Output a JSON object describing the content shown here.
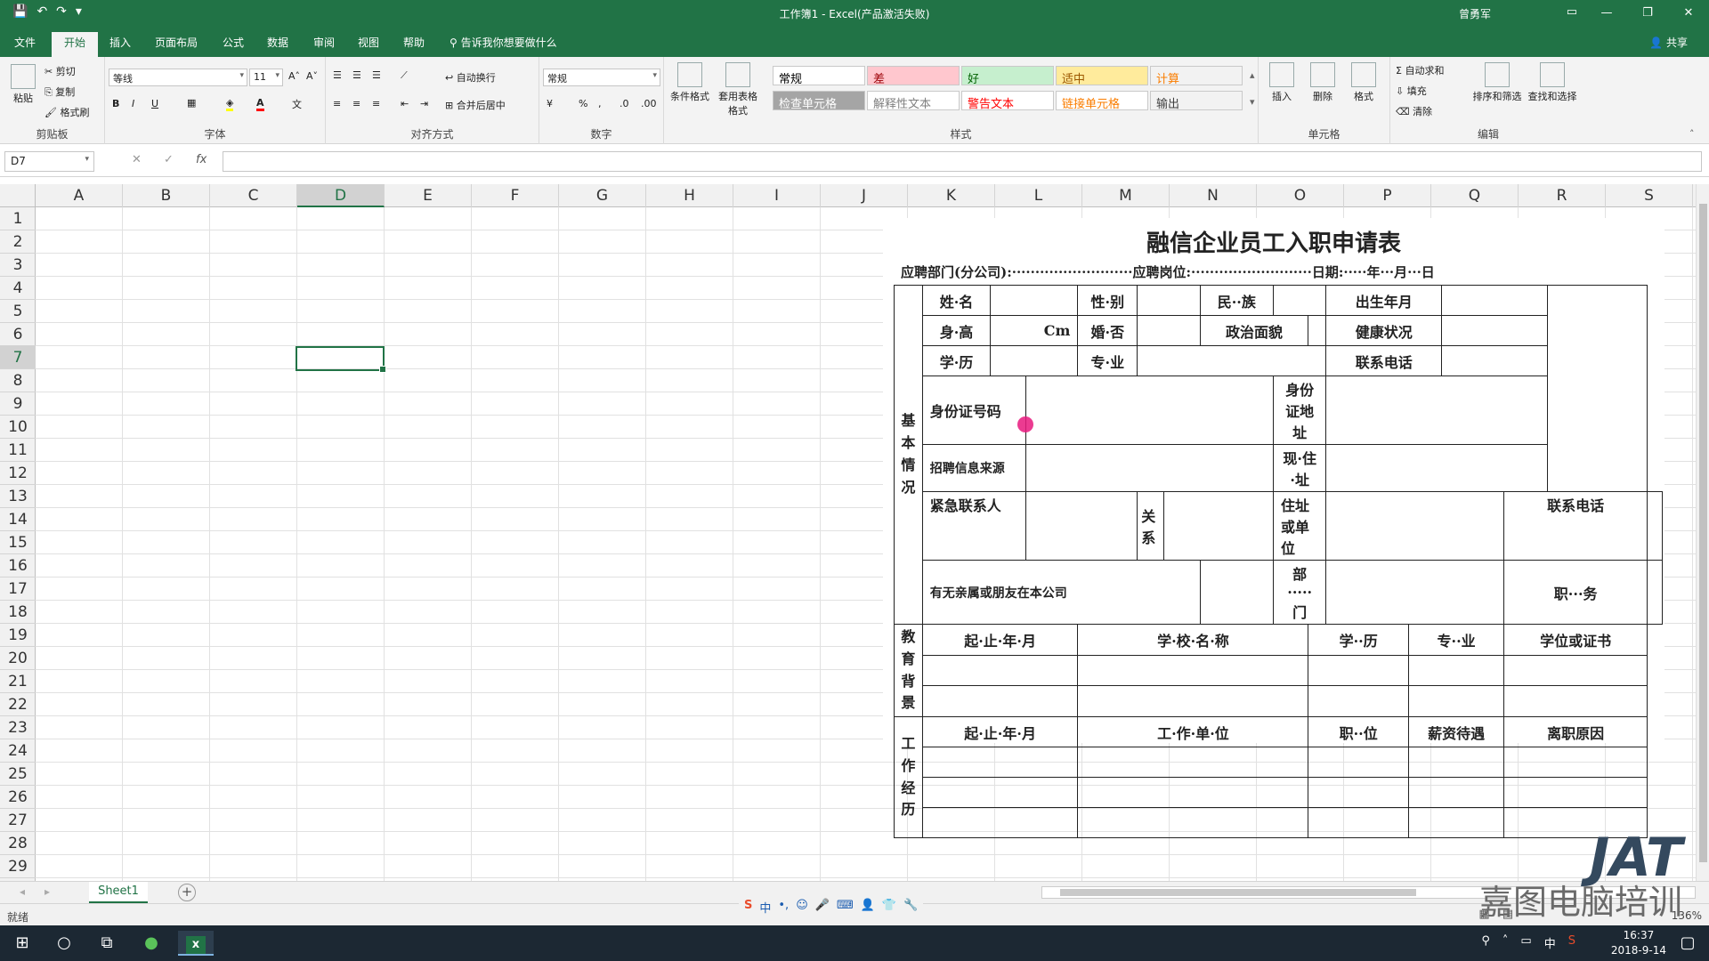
{
  "window": {
    "title": "工作簿1 - Excel(产品激活失败)",
    "user": "曾勇军",
    "minimize": "—",
    "restore": "❐",
    "close": "✕"
  },
  "qat": {
    "save": "💾",
    "undo": "↶",
    "redo": "↷",
    "customize": "▾"
  },
  "tabs": [
    "文件",
    "开始",
    "插入",
    "页面布局",
    "公式",
    "数据",
    "审阅",
    "视图",
    "帮助"
  ],
  "tell_me": "告诉我你想要做什么",
  "share": "共享",
  "ribbon": {
    "clipboard": {
      "label": "剪贴板",
      "paste": "粘贴",
      "cut": "剪切",
      "copy": "复制",
      "format_painter": "格式刷"
    },
    "font": {
      "label": "字体",
      "name": "等线",
      "size": "11",
      "bold": "B",
      "italic": "I",
      "underline": "U",
      "grow": "A˄",
      "shrink": "A˅"
    },
    "alignment": {
      "label": "对齐方式",
      "wrap": "自动换行",
      "merge": "合并后居中"
    },
    "number": {
      "label": "数字",
      "format": "常规",
      "percent": "%",
      "comma": ","
    },
    "styles": {
      "label": "样式",
      "conditional": "条件格式",
      "as_table": "套用表格格式",
      "cells": [
        {
          "text": "常规",
          "bg": "#ffffff",
          "fg": "#000000"
        },
        {
          "text": "差",
          "bg": "#ffc7ce",
          "fg": "#9c0006"
        },
        {
          "text": "好",
          "bg": "#c6efce",
          "fg": "#006100"
        },
        {
          "text": "适中",
          "bg": "#ffeb9c",
          "fg": "#9c5700"
        },
        {
          "text": "计算",
          "bg": "#f2f2f2",
          "fg": "#fa7d00"
        },
        {
          "text": "检查单元格",
          "bg": "#a5a5a5",
          "fg": "#ffffff"
        },
        {
          "text": "解释性文本",
          "bg": "#ffffff",
          "fg": "#7f7f7f"
        },
        {
          "text": "警告文本",
          "bg": "#ffffff",
          "fg": "#ff0000"
        },
        {
          "text": "链接单元格",
          "bg": "#ffffff",
          "fg": "#fa7d00"
        },
        {
          "text": "输出",
          "bg": "#f2f2f2",
          "fg": "#3f3f3f"
        }
      ]
    },
    "cells": {
      "label": "单元格",
      "insert": "插入",
      "delete": "删除",
      "format": "格式"
    },
    "editing": {
      "label": "编辑",
      "autosum": "自动求和",
      "fill": "填充",
      "clear": "清除",
      "sort": "排序和筛选",
      "find": "查找和选择"
    }
  },
  "formula_bar": {
    "name_box": "D7",
    "cancel": "✕",
    "enter": "✓",
    "fx": "fx",
    "value": ""
  },
  "columns": [
    "A",
    "B",
    "C",
    "D",
    "E",
    "F",
    "G",
    "H",
    "I",
    "J",
    "K",
    "L",
    "M",
    "N",
    "O",
    "P",
    "Q",
    "R",
    "S"
  ],
  "rows": [
    "1",
    "2",
    "3",
    "4",
    "5",
    "6",
    "7",
    "8",
    "9",
    "10",
    "11",
    "12",
    "13",
    "14",
    "15",
    "16",
    "17",
    "18",
    "19",
    "20",
    "21",
    "22",
    "23",
    "24",
    "25",
    "26",
    "27",
    "28",
    "29"
  ],
  "selected": {
    "column": "D",
    "row": "7"
  },
  "form": {
    "title": "融信企业员工入职申请表",
    "subtitle": "应聘部门(分公司):··························应聘岗位:··························日期:·····年···月···日",
    "basic_section": "基本情况",
    "name": "姓·名",
    "gender": "性·别",
    "ethnicity": "民··族",
    "birth": "出生年月",
    "height": "身·高",
    "height_unit": "Cm",
    "marital": "婚·否",
    "politics": "政治面貌",
    "health": "健康状况",
    "education": "学·历",
    "major": "专·业",
    "phone": "联系电话",
    "id_number": "身份证号码",
    "id_address": "身份证地址",
    "source": "招聘信息来源",
    "current_address": "现·住·址",
    "emergency": "紧急联系人",
    "relation": "关系",
    "address_or_unit": "住址或单位",
    "phone2": "联系电话",
    "relatives": "有无亲属或朋友在本公司",
    "department": "部·····门",
    "position": "职···务",
    "edu_section": "教育背景",
    "edu_headers": [
      "起·止·年·月",
      "学·校·名·称",
      "学··历",
      "专··业",
      "学位或证书"
    ],
    "work_section": "工作经历",
    "work_headers": [
      "起·止·年·月",
      "工·作·单·位",
      "职··位",
      "薪资待遇",
      "离职原因"
    ]
  },
  "sheet_tab": "Sheet1",
  "add_sheet": "+",
  "status": {
    "ready": "就绪",
    "zoom": "136%"
  },
  "ime": [
    "S",
    "中",
    "•,",
    "☺",
    "🎤",
    "⌨",
    "👤",
    "👕",
    "🔧"
  ],
  "clock": {
    "time": "16:37",
    "date": "2018-9-14"
  },
  "taskbar": {
    "ime_tray": "中"
  },
  "watermark": {
    "logo": "JAT",
    "text": "嘉图电脑培训"
  }
}
